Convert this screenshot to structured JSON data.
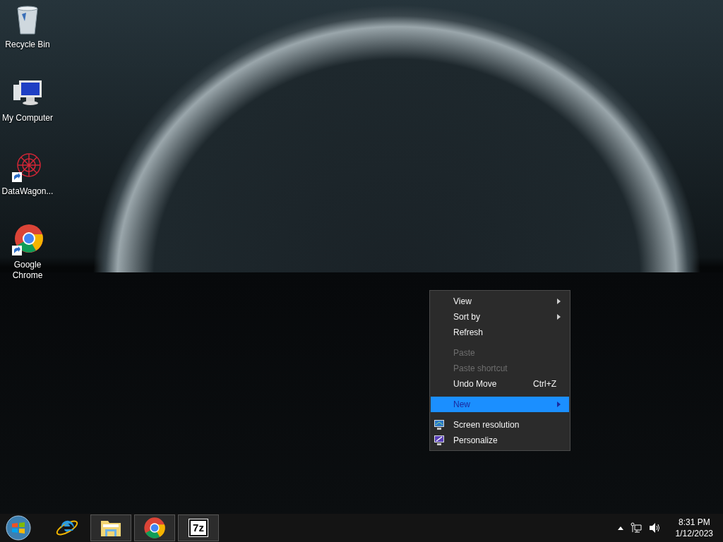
{
  "desktop_icons": [
    {
      "kind": "recycle-bin",
      "label": "Recycle Bin",
      "shortcut": false
    },
    {
      "kind": "computer",
      "label": "My Computer",
      "shortcut": false
    },
    {
      "kind": "molecule-app",
      "label": "DataWagon...",
      "shortcut": true
    },
    {
      "kind": "chrome",
      "label": "Google Chrome",
      "shortcut": true
    }
  ],
  "context_menu": [
    {
      "kind": "item",
      "label": "View",
      "submenu": true,
      "disabled": false,
      "selected": false
    },
    {
      "kind": "item",
      "label": "Sort by",
      "submenu": true,
      "disabled": false,
      "selected": false
    },
    {
      "kind": "item",
      "label": "Refresh",
      "submenu": false,
      "disabled": false,
      "selected": false
    },
    {
      "kind": "separator"
    },
    {
      "kind": "item",
      "label": "Paste",
      "submenu": false,
      "disabled": true,
      "selected": false
    },
    {
      "kind": "item",
      "label": "Paste shortcut",
      "submenu": false,
      "disabled": true,
      "selected": false
    },
    {
      "kind": "item",
      "label": "Undo Move",
      "shortcut": "Ctrl+Z",
      "submenu": false,
      "disabled": false,
      "selected": false
    },
    {
      "kind": "separator"
    },
    {
      "kind": "item",
      "label": "New",
      "submenu": true,
      "disabled": false,
      "selected": true
    },
    {
      "kind": "separator"
    },
    {
      "kind": "display-item",
      "label": "Screen resolution",
      "submenu": false,
      "disabled": false,
      "selected": false
    },
    {
      "kind": "personalize-item",
      "label": "Personalize",
      "submenu": false,
      "disabled": false,
      "selected": false
    }
  ],
  "taskbar": {
    "items": [
      {
        "kind": "ie",
        "running": false
      },
      {
        "kind": "explorer",
        "running": true
      },
      {
        "kind": "chrome",
        "running": true
      },
      {
        "kind": "sevenzip",
        "label": "7z",
        "running": true
      }
    ],
    "clock": {
      "time": "8:31 PM",
      "date": "1/12/2023"
    }
  }
}
